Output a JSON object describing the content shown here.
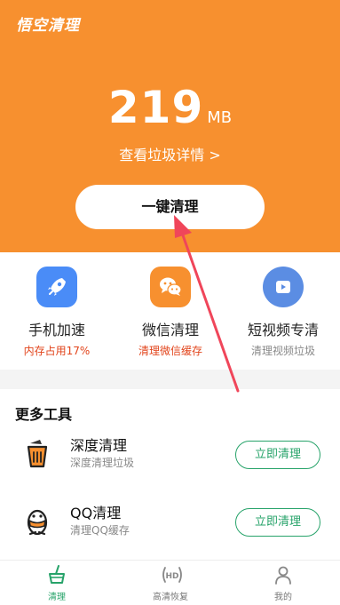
{
  "app": {
    "title": "悟空清理"
  },
  "hero": {
    "junk_size": "219",
    "junk_unit": "MB",
    "detail_link": "查看垃圾详情 >",
    "clean_button": "一键清理"
  },
  "quick_actions": [
    {
      "label": "手机加速",
      "sub": "内存占用17%",
      "icon": "rocket-icon"
    },
    {
      "label": "微信清理",
      "sub": "清理微信缓存",
      "icon": "wechat-icon"
    },
    {
      "label": "短视频专清",
      "sub": "清理视频垃圾",
      "icon": "video-play-icon"
    }
  ],
  "tools": {
    "title": "更多工具",
    "items": [
      {
        "name": "深度清理",
        "desc": "深度清理垃圾",
        "button": "立即清理",
        "icon": "trash-bin-icon"
      },
      {
        "name": "QQ清理",
        "desc": "清理QQ缓存",
        "button": "立即清理",
        "icon": "qq-penguin-icon"
      }
    ]
  },
  "tabbar": {
    "tabs": [
      {
        "label": "清理",
        "icon": "broom-basket-icon"
      },
      {
        "label": "高清恢复",
        "icon": "hd-icon"
      },
      {
        "label": "我的",
        "icon": "user-icon"
      }
    ]
  },
  "colors": {
    "hero_bg": "#f7902f",
    "accent_green": "#27a36a",
    "warning_red": "#e2441b",
    "arrow": "#f0465a"
  }
}
